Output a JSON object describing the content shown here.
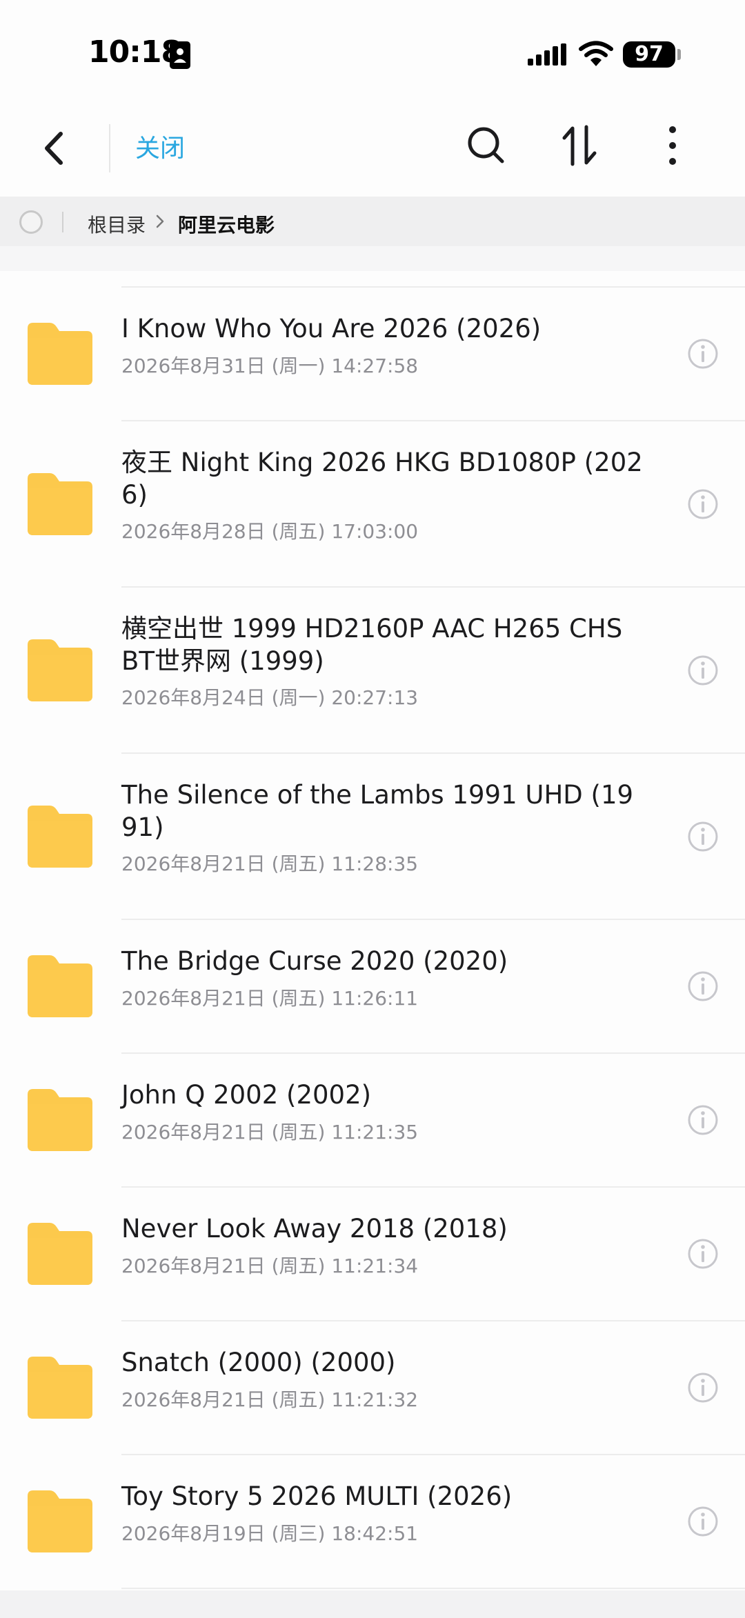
{
  "status_bar": {
    "time": "10:18",
    "battery": "97"
  },
  "nav": {
    "close_label": "关闭"
  },
  "breadcrumb": {
    "root": "根目录",
    "current": "阿里云电影"
  },
  "colors": {
    "accent": "#2aa7e0",
    "folder": "#fcc94c",
    "divider": "#ececec"
  },
  "icons": {
    "back": "chevron-left-icon",
    "search": "search-icon",
    "sort": "sort-icon",
    "more": "more-vertical-icon",
    "folder": "folder-icon",
    "info": "info-icon"
  },
  "files": [
    {
      "name": "I Know Who You Are 2026 (2026)",
      "date": "2026年8月31日 (周一) 14:27:58"
    },
    {
      "name": "夜王 Night King 2026 HKG BD1080P (2026)",
      "date": "2026年8月28日 (周五) 17:03:00"
    },
    {
      "name": "横空出世 1999 HD2160P AAC H265 CHS BT世界网 (1999)",
      "date": "2026年8月24日 (周一) 20:27:13"
    },
    {
      "name": "The Silence of the Lambs 1991 UHD (1991)",
      "date": "2026年8月21日 (周五) 11:28:35"
    },
    {
      "name": "The Bridge Curse 2020 (2020)",
      "date": "2026年8月21日 (周五) 11:26:11"
    },
    {
      "name": "John Q 2002 (2002)",
      "date": "2026年8月21日 (周五) 11:21:35"
    },
    {
      "name": "Never Look Away 2018 (2018)",
      "date": "2026年8月21日 (周五) 11:21:34"
    },
    {
      "name": "Snatch (2000) (2000)",
      "date": "2026年8月21日 (周五) 11:21:32"
    },
    {
      "name": "Toy Story 5 2026 MULTI (2026)",
      "date": "2026年8月19日 (周三) 18:42:51"
    }
  ]
}
